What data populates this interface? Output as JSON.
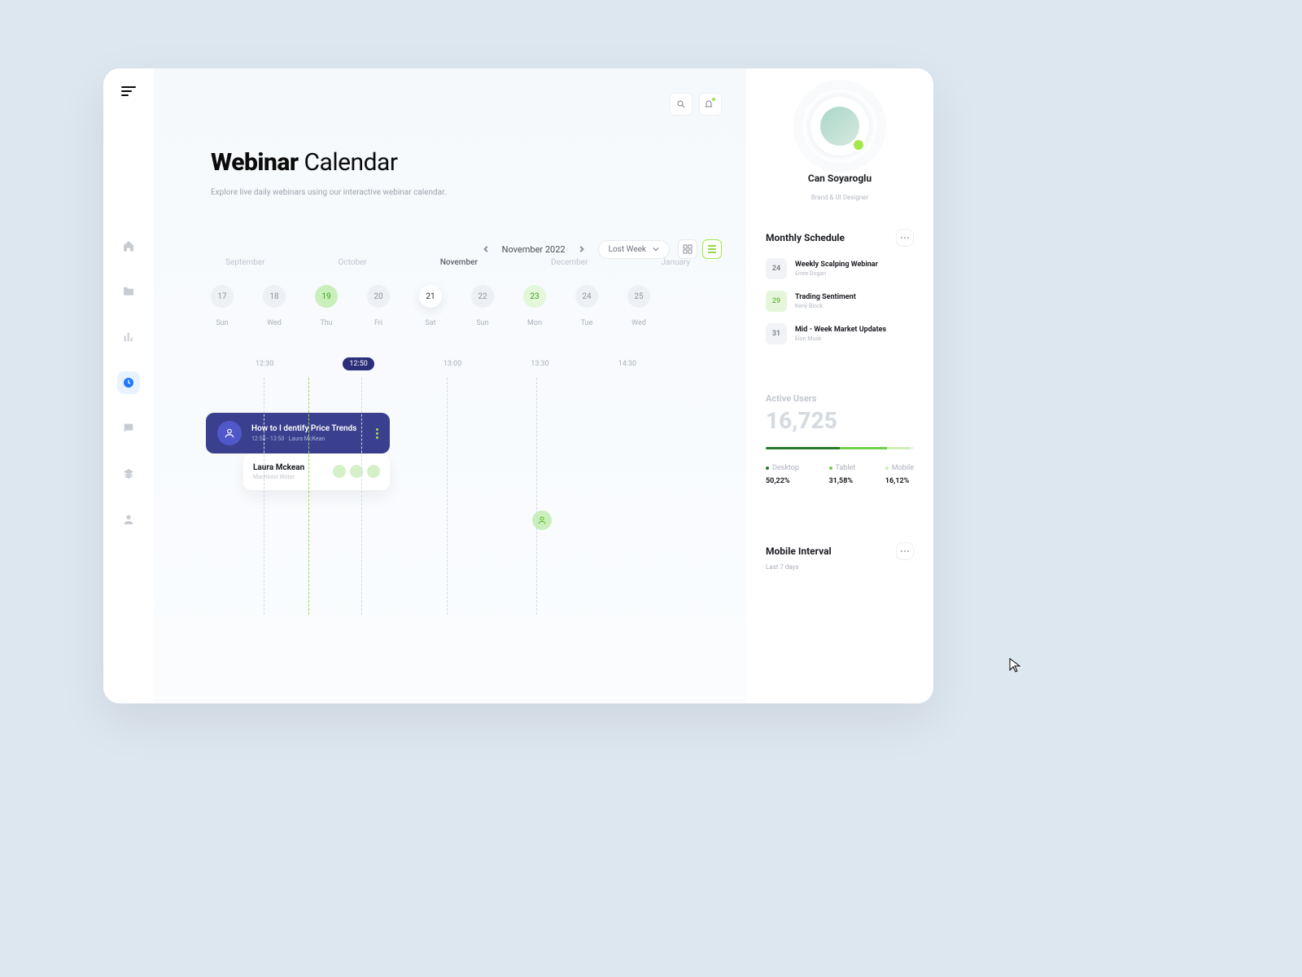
{
  "header": {
    "title_bold": "Webinar",
    "title_light": "Calendar",
    "subtitle": "Explore live daily webinars using our interactive webinar calendar.",
    "month": "November 2022",
    "filter": "Lost Week"
  },
  "nav": [
    "home",
    "folder",
    "chart",
    "clock",
    "chat",
    "layers",
    "user"
  ],
  "months": [
    {
      "label": "September",
      "current": false
    },
    {
      "label": "October",
      "current": false
    },
    {
      "label": "November",
      "current": true
    },
    {
      "label": "December",
      "current": false
    },
    {
      "label": "January",
      "current": false
    }
  ],
  "dates": [
    {
      "num": "17",
      "day": "Sun",
      "style": "plain"
    },
    {
      "num": "18",
      "day": "Wed",
      "style": "plain"
    },
    {
      "num": "19",
      "day": "Thu",
      "style": "green"
    },
    {
      "num": "20",
      "day": "Fri",
      "style": "plain"
    },
    {
      "num": "21",
      "day": "Sat",
      "style": "white"
    },
    {
      "num": "22",
      "day": "Sun",
      "style": "plain"
    },
    {
      "num": "23",
      "day": "Mon",
      "style": "green soft"
    },
    {
      "num": "24",
      "day": "Tue",
      "style": "plain"
    },
    {
      "num": "25",
      "day": "Wed",
      "style": "plain"
    }
  ],
  "timeline": {
    "times": [
      "12:30",
      "12:50",
      "13:00",
      "13:30",
      "14:30"
    ],
    "badge_index": 1,
    "event": {
      "title": "How to I dentify Price Trends",
      "time": "12:50 - 13:50",
      "host": "Laura McKean"
    },
    "presenter": {
      "name": "Laura Mckean",
      "role": "Machinist Writer"
    }
  },
  "profile": {
    "name": "Can Soyaroglu",
    "role": "Brand & UI Designer"
  },
  "schedule": {
    "title": "Monthly Schedule",
    "items": [
      {
        "date": "24",
        "title": "Weekly Scalping Webinar",
        "author": "Emre Dogan",
        "style": ""
      },
      {
        "date": "29",
        "title": "Trading Sentiment",
        "author": "Keny Block",
        "style": "green"
      },
      {
        "date": "31",
        "title": "Mid - Week Market Updates",
        "author": "Elon Musk",
        "style": ""
      }
    ]
  },
  "active_users": {
    "label": "Active Users",
    "value": "16,725",
    "segments": [
      {
        "label": "Desktop",
        "value": "50,22%",
        "color": "#2a7a2e",
        "width": 50
      },
      {
        "label": "Tablet",
        "value": "31,58%",
        "color": "#6fd14a",
        "width": 32
      },
      {
        "label": "Mobile",
        "value": "16,12%",
        "color": "#cfeeb8",
        "width": 16
      }
    ]
  },
  "mobile_interval": {
    "title": "Mobile Interval",
    "sub": "Last 7 days"
  }
}
